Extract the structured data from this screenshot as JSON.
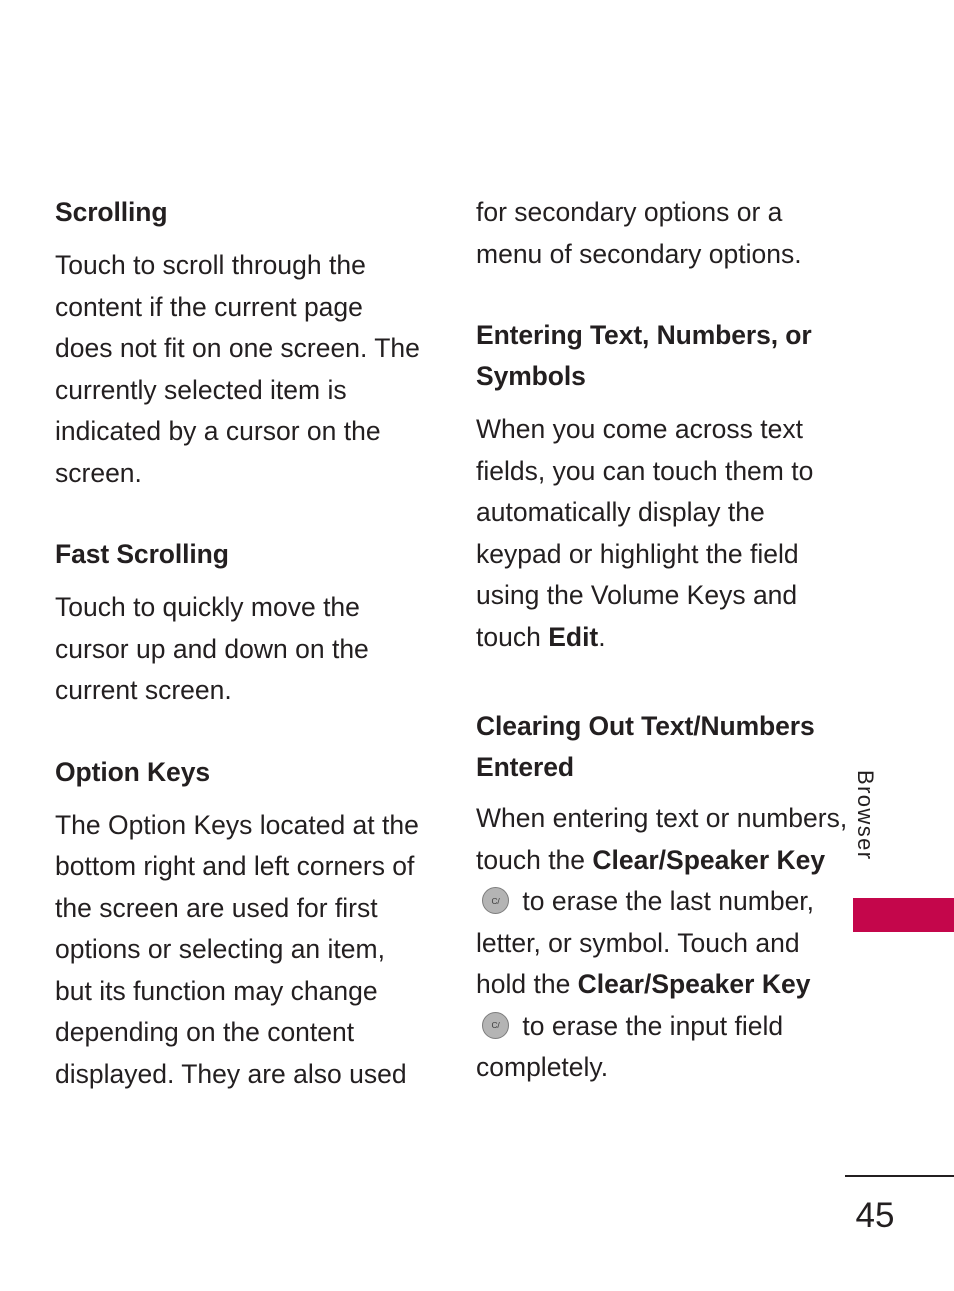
{
  "document": {
    "page_number": "45",
    "side_tab": {
      "label": "Browser",
      "accent_color": "#c4064b"
    }
  },
  "left_column": {
    "sections": [
      {
        "heading": "Scrolling",
        "paragraph": "Touch to scroll through the content if the current page does not fit on one screen. The currently selected item is indicated by a cursor on the screen."
      },
      {
        "heading": "Fast Scrolling",
        "paragraph": "Touch to quickly move the cursor up and down on the current screen."
      },
      {
        "heading": "Option Keys",
        "paragraph": "The Option Keys located at the bottom right and left corners of the screen are used for first options or selecting an item, but its function may change depending on the content displayed. They are also used"
      }
    ]
  },
  "right_column": {
    "continuation_paragraph": "for secondary options or a menu of secondary options.",
    "sections": [
      {
        "heading": "Entering Text, Numbers, or Symbols",
        "paragraph_part_1": "When you come across text fields, you can touch them to automatically display the keypad or highlight the field using the Volume Keys and touch ",
        "paragraph_bold_1": "Edit",
        "paragraph_part_2": "."
      },
      {
        "heading": "Clearing Out Text/Numbers Entered",
        "paragraph_part_1": "When entering text or numbers, touch the ",
        "paragraph_bold_1": "Clear/Speaker Key",
        "paragraph_part_2": " to erase the last number, letter, or symbol. Touch and hold the ",
        "paragraph_bold_2": "Clear/Speaker Key",
        "paragraph_part_3": " to erase the input field completely."
      }
    ]
  },
  "icons": {
    "clear_speaker_key": {
      "name": "clear-speaker-key-icon",
      "glyph_text": "C/",
      "speaker_glyph": "◂))",
      "fill_color": "#b4b4b4",
      "border_color": "#7d7d7d"
    }
  }
}
